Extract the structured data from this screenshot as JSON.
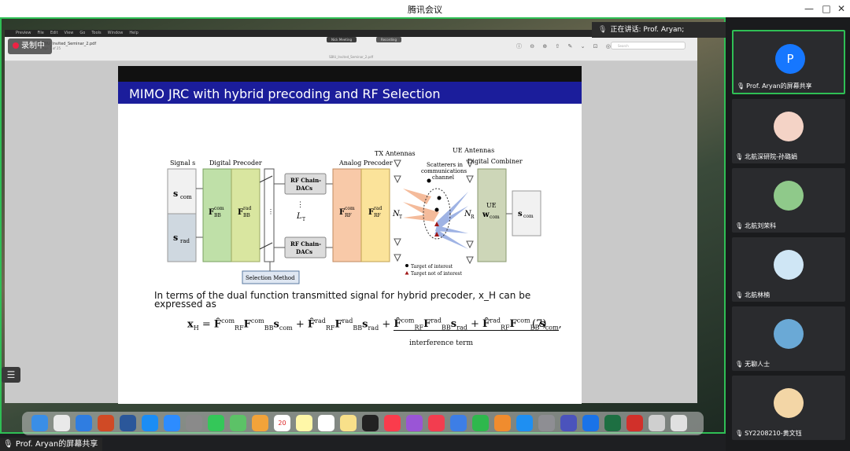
{
  "app": {
    "title": "腾讯会议"
  },
  "window_controls": {
    "minimize": "—",
    "maximize": "□",
    "close": "✕"
  },
  "mac_menu": [
    "Preview",
    "File",
    "Edit",
    "View",
    "Go",
    "Tools",
    "Window",
    "Help"
  ],
  "recording": {
    "badge": "录制中",
    "pill_a": "Nick Meeting",
    "pill_b": "Recording"
  },
  "preview": {
    "filename": "SBIU_Invited_Seminar_2.pdf",
    "pages": "Page 1 of 25",
    "subtitle": "SBIU_Invited_Seminar_2.pdf",
    "tools": "ⓘ ⊖ ⊕ ⇧ ✎ ⌄ ⊡ ◎",
    "search_placeholder": "Search"
  },
  "slide": {
    "title": "MIMO JRC with hybrid precoding and RF Selection",
    "paragraph": "In terms of the dual function transmitted signal for hybrid precoder, x_H can be expressed as",
    "eq_number": "(7)",
    "brace_label": "interference term",
    "diagram": {
      "signal_label": "Signal s",
      "digital_precoder": "Digital Precoder",
      "analog_precoder": "Analog Precoder",
      "tx_antennas": "TX Antennas",
      "ue_antennas": "UE Antennas",
      "digital_combiner": "Digital Combiner",
      "scatterers": "Scatterers in communications channel",
      "rf_chain": "RF Chain-DACs",
      "lt": "L",
      "selection": "Selection Method",
      "target": "Target of interest",
      "non_target": "Target not of interest",
      "scom": "s",
      "srad": "s",
      "ue": "UE",
      "nt": "N",
      "nr": "N"
    }
  },
  "speaking": {
    "text": "正在讲话: Prof. Aryan;"
  },
  "presenter": {
    "text": "Prof. Aryan的屏幕共享"
  },
  "participants": [
    {
      "name": "Prof. Aryan的屏幕共享",
      "initial": "P",
      "color": "#1677ff"
    },
    {
      "name": "北航深研院-孙璐娟",
      "color": "#f4d3c6"
    },
    {
      "name": "北航刘荣科",
      "color": "#8fc98a"
    },
    {
      "name": "北航林楠",
      "color": "#cfe6f5"
    },
    {
      "name": "无聊人士",
      "color": "#6aa9d6"
    },
    {
      "name": "SY2208210-黄文钰",
      "color": "#f3d6a6"
    }
  ],
  "dock_apps": [
    "Finder",
    "Chrome",
    "Mail",
    "PowerPoint",
    "Word",
    "Safari",
    "Zoom",
    "Launchpad",
    "Messages",
    "Maps",
    "Photos",
    "Calendar",
    "Notes",
    "Reminders",
    "Stickies",
    "TV",
    "Music",
    "Podcasts",
    "News",
    "Keynote",
    "Numbers",
    "Pages",
    "App Store",
    "Settings",
    "Teams",
    "Meet",
    "Excel",
    "Acrobat",
    "Preview",
    "Trash"
  ],
  "dock_date": "20"
}
